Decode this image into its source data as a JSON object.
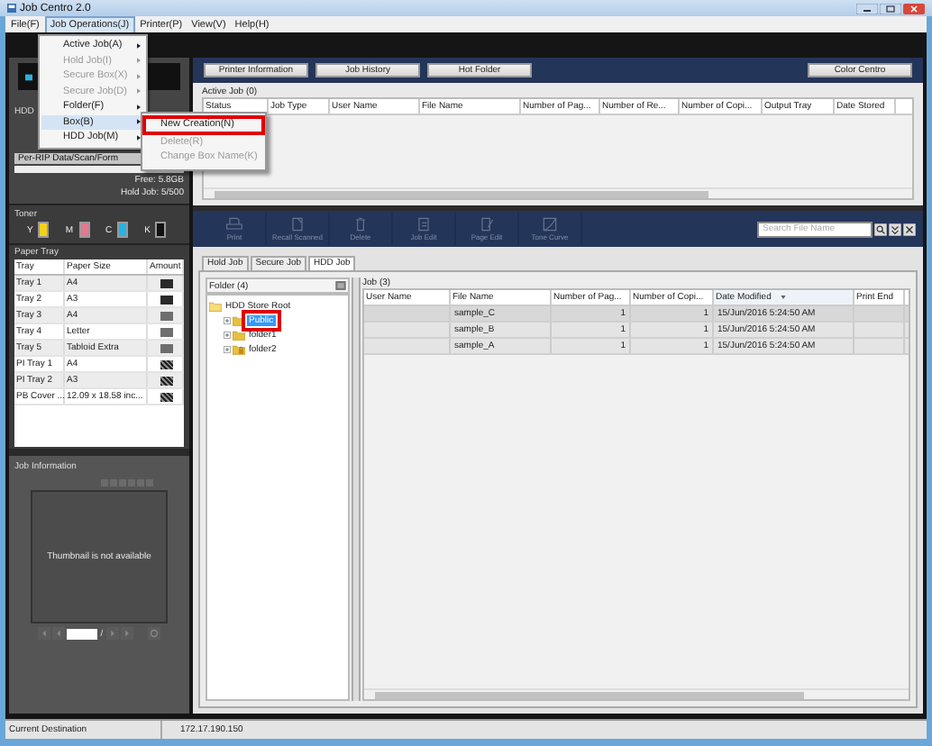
{
  "window": {
    "title": "Job Centro 2.0"
  },
  "menu_bar": [
    {
      "label": "File(F)",
      "selected": false
    },
    {
      "label": "Job Operations(J)",
      "selected": true
    },
    {
      "label": "Printer(P)",
      "selected": false
    },
    {
      "label": "View(V)",
      "selected": false
    },
    {
      "label": "Help(H)",
      "selected": false
    }
  ],
  "dropdown": [
    {
      "label": "Active Job(A)",
      "disabled": false,
      "selected": false
    },
    {
      "label": "Hold Job(I)",
      "disabled": true,
      "selected": false
    },
    {
      "label": "Secure Box(X)",
      "disabled": true,
      "selected": false
    },
    {
      "label": "Secure Job(D)",
      "disabled": true,
      "selected": false
    },
    {
      "label": "Folder(F)",
      "disabled": false,
      "selected": false
    },
    {
      "label": "Box(B)",
      "disabled": false,
      "selected": true
    },
    {
      "label": "HDD Job(M)",
      "disabled": false,
      "selected": false
    }
  ],
  "submenu": [
    {
      "label": "New Creation(N)",
      "disabled": false,
      "marked": true
    },
    {
      "label": "Delete(R)",
      "disabled": true,
      "marked": false
    },
    {
      "label": "Change Box Name(K)",
      "disabled": true,
      "marked": false
    }
  ],
  "device": {
    "hdd_label": "HDD",
    "storage_label": "Per-RIP Data/Scan/Form",
    "free": "Free: 5.8GB",
    "hold_job": "Hold Job: 5/500"
  },
  "toner": {
    "title": "Toner",
    "items": [
      {
        "label": "Y",
        "color": "#f2d21c"
      },
      {
        "label": "M",
        "color": "#e8768e"
      },
      {
        "label": "C",
        "color": "#22b4e4"
      },
      {
        "label": "K",
        "color": "#111111"
      }
    ]
  },
  "paper_tray": {
    "title": "Paper Tray",
    "columns": [
      "Tray",
      "Paper Size",
      "Amount"
    ],
    "rows": [
      {
        "tray": "Tray 1",
        "size": "A4",
        "kind": "full"
      },
      {
        "tray": "Tray 2",
        "size": "A3",
        "kind": "full"
      },
      {
        "tray": "Tray 3",
        "size": "A4",
        "kind": "low"
      },
      {
        "tray": "Tray 4",
        "size": "Letter",
        "kind": "low"
      },
      {
        "tray": "Tray 5",
        "size": "Tabloid Extra",
        "kind": "low"
      },
      {
        "tray": "PI Tray 1",
        "size": "A4",
        "kind": "unknown"
      },
      {
        "tray": "PI Tray 2",
        "size": "A3",
        "kind": "unknown"
      },
      {
        "tray": "PB Cover ...",
        "size": "12.09 x 18.58 inc...",
        "kind": "unknown"
      }
    ]
  },
  "job_information": {
    "title": "Job Information",
    "thumbnail_text": "Thumbnail is not available",
    "page_separator": "/"
  },
  "top_buttons": [
    "Printer Information",
    "Job History",
    "Hot Folder",
    "Color Centro"
  ],
  "active_job": {
    "title": "Active Job (0)",
    "columns": [
      "Status",
      "Job Type",
      "User Name",
      "File Name",
      "Number of Pag...",
      "Number of  Re...",
      "Number of Copi...",
      "Output Tray",
      "Date Stored"
    ]
  },
  "toolbar": [
    {
      "label": "Print",
      "kind": "print",
      "disabled": true
    },
    {
      "label": "Recall Scanned",
      "kind": "recall",
      "disabled": true
    },
    {
      "label": "Delete",
      "kind": "delete",
      "disabled": true
    },
    {
      "label": "Job Edit",
      "kind": "job-edit",
      "disabled": true
    },
    {
      "label": "Page Edit",
      "kind": "page-edit",
      "disabled": true
    },
    {
      "label": "Tone Curve",
      "kind": "tone-curve",
      "disabled": true
    }
  ],
  "search": {
    "placeholder": "Search File Name"
  },
  "job_tabs": [
    {
      "label": "Hold Job",
      "selected": false
    },
    {
      "label": "Secure Job",
      "selected": false
    },
    {
      "label": "HDD Job",
      "selected": true
    }
  ],
  "folders": {
    "title": "Folder (4)",
    "tree": [
      {
        "label": "HDD Store Root",
        "expanded": true,
        "selected": false,
        "locked": false,
        "marked": false,
        "children": [
          {
            "label": "Public",
            "expanded": false,
            "selected": true,
            "locked": false,
            "marked": true
          },
          {
            "label": "folder1",
            "expanded": false,
            "selected": false,
            "locked": false,
            "marked": false
          },
          {
            "label": "folder2",
            "expanded": false,
            "selected": false,
            "locked": true,
            "marked": false
          }
        ]
      }
    ]
  },
  "jobs": {
    "title": "Job (3)",
    "columns": [
      {
        "label": "User Name",
        "sorted": false
      },
      {
        "label": "File Name",
        "sorted": false
      },
      {
        "label": "Number of Pag...",
        "sorted": false
      },
      {
        "label": "Number of Copi...",
        "sorted": false
      },
      {
        "label": "Date Modified",
        "sorted": true
      },
      {
        "label": "Print End",
        "sorted": false
      }
    ],
    "rows": [
      {
        "file": "sample_C",
        "pages": "1",
        "copies": "1",
        "date": "15/Jun/2016 5:24:50 AM"
      },
      {
        "file": "sample_B",
        "pages": "1",
        "copies": "1",
        "date": "15/Jun/2016 5:24:50 AM"
      },
      {
        "file": "sample_A",
        "pages": "1",
        "copies": "1",
        "date": "15/Jun/2016 5:24:50 AM"
      }
    ]
  },
  "status_bar": {
    "label": "Current Destination",
    "value": "172.17.190.150"
  }
}
